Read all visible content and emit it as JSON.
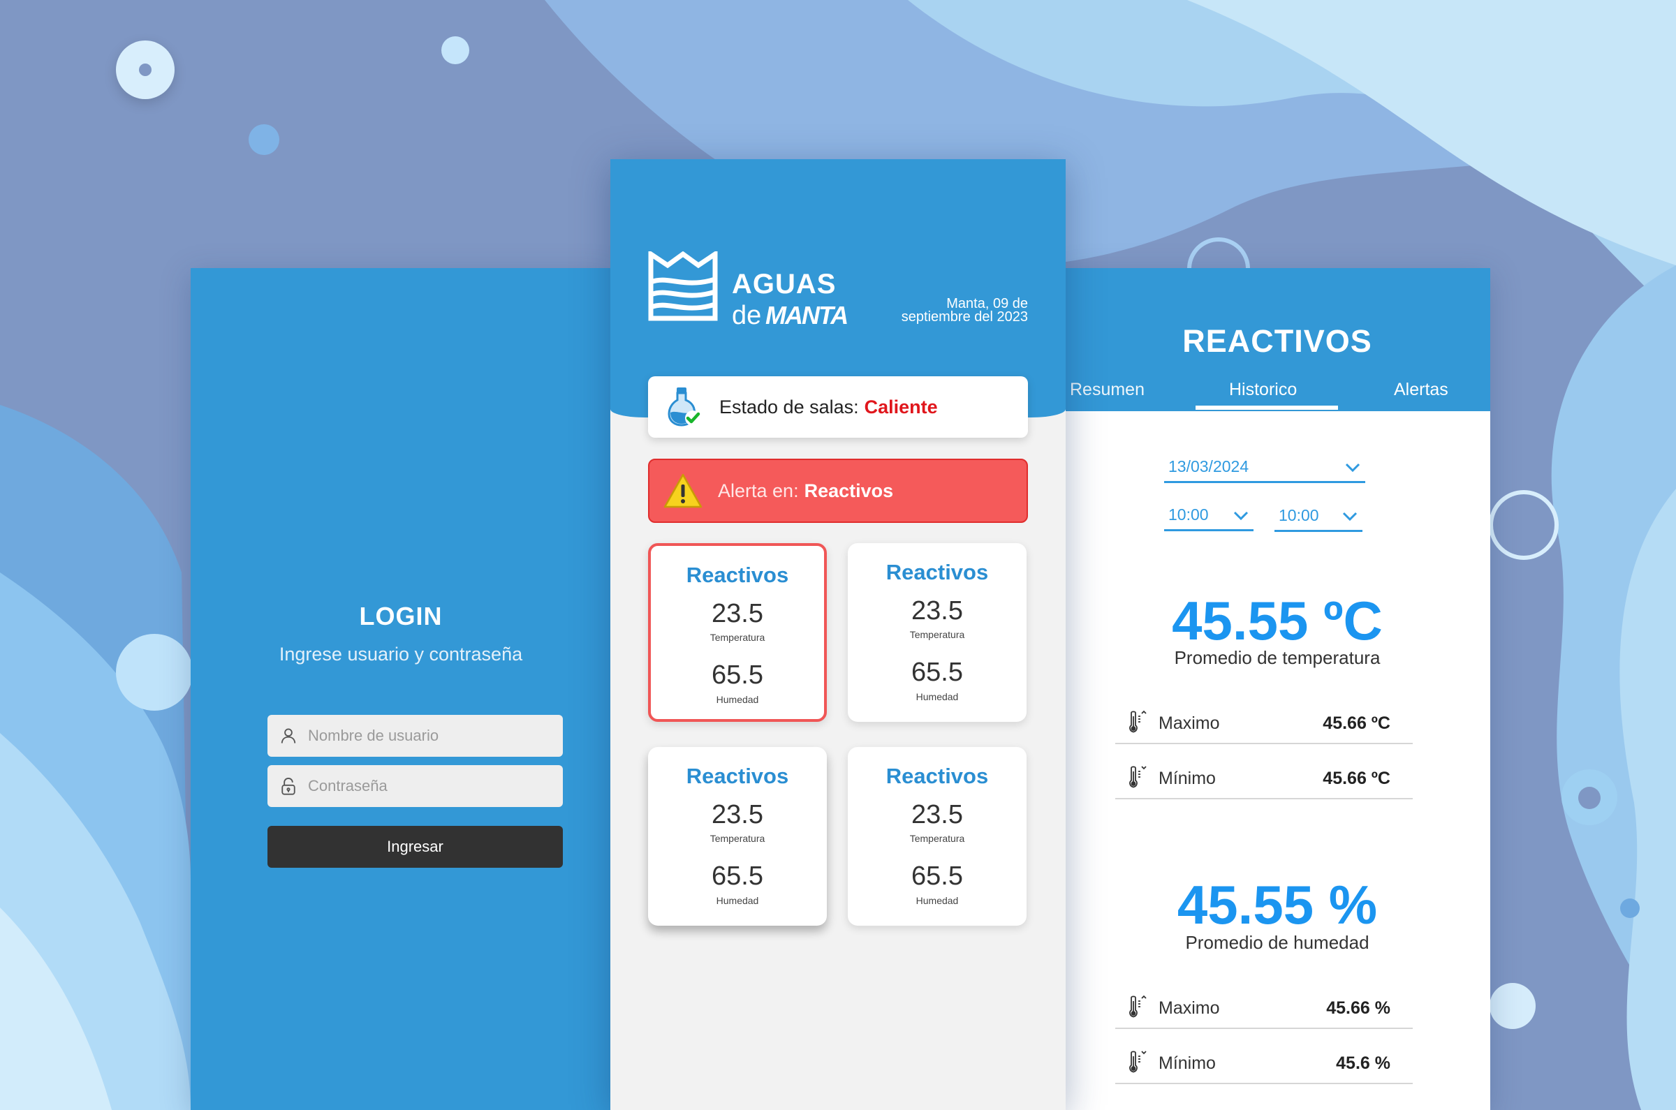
{
  "login": {
    "title": "LOGIN",
    "subtitle": "Ingrese usuario y contraseña",
    "username_placeholder": "Nombre de usuario",
    "password_placeholder": "Contraseña",
    "submit_label": "Ingresar"
  },
  "dashboard": {
    "brand_top": "AGUAS",
    "brand_de": "de",
    "brand_manta": "MANTA",
    "date_line1": "Manta, 09 de",
    "date_line2": "septiembre del 2023",
    "status_label": "Estado de salas:",
    "status_value": "Caliente",
    "alert_label": "Alerta en:",
    "alert_value": "Reactivos",
    "rooms": [
      {
        "name": "Reactivos",
        "temperature": "23.5",
        "temperature_label": "Temperatura",
        "humidity": "65.5",
        "humidity_label": "Humedad",
        "alert": true
      },
      {
        "name": "Reactivos",
        "temperature": "23.5",
        "temperature_label": "Temperatura",
        "humidity": "65.5",
        "humidity_label": "Humedad",
        "alert": false
      },
      {
        "name": "Reactivos",
        "temperature": "23.5",
        "temperature_label": "Temperatura",
        "humidity": "65.5",
        "humidity_label": "Humedad",
        "alert": false
      },
      {
        "name": "Reactivos",
        "temperature": "23.5",
        "temperature_label": "Temperatura",
        "humidity": "65.5",
        "humidity_label": "Humedad",
        "alert": false
      }
    ]
  },
  "reactivos": {
    "title": "REACTIVOS",
    "tabs": [
      "Resumen",
      "Historico",
      "Alertas"
    ],
    "active_tab": "Historico",
    "date": "13/03/2024",
    "time_from": "10:00",
    "time_to": "10:00",
    "temperature": {
      "average": "45.55 ºC",
      "average_label": "Promedio de temperatura",
      "max_label": "Maximo",
      "max_value": "45.66 ºC",
      "min_label": "Mínimo",
      "min_value": "45.66 ºC"
    },
    "humidity": {
      "average": "45.55 %",
      "average_label": "Promedio de humedad",
      "max_label": "Maximo",
      "max_value": "45.66 %",
      "min_label": "Mínimo",
      "min_value": "45.6 %"
    }
  },
  "icons": [
    "user-icon",
    "lock-icon",
    "flask-check-icon",
    "warning-icon",
    "chevron-down-icon",
    "thermometer-up-icon",
    "thermometer-down-icon",
    "aguas-de-manta-logo"
  ],
  "colors": {
    "primary_blue": "#3398d6",
    "accent_blue": "#1b95f0",
    "alert_red": "#f55a5a",
    "status_red": "#e0161c",
    "button_dark": "#323232"
  }
}
